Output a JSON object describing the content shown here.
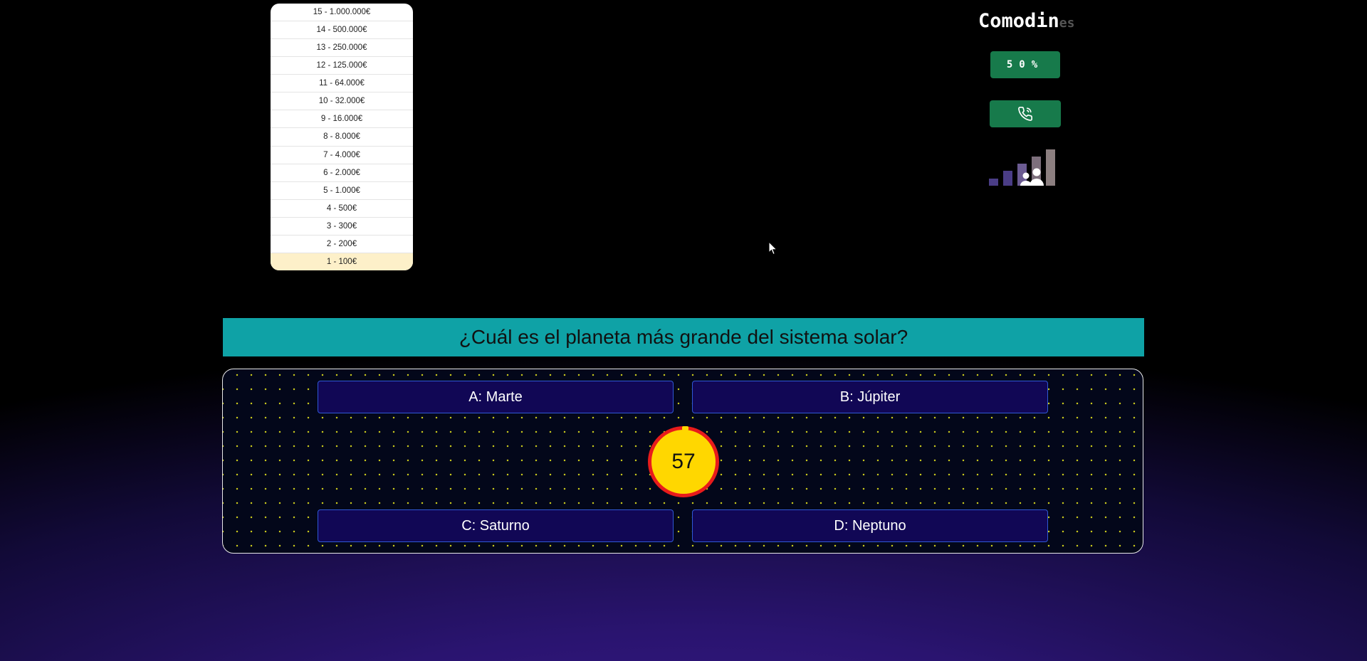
{
  "prize_ladder": {
    "levels": [
      "15 - 1.000.000€",
      "14 - 500.000€",
      "13 - 250.000€",
      "12 - 125.000€",
      "11 - 64.000€",
      "10 - 32.000€",
      "9 - 16.000€",
      "8 - 8.000€",
      "7 - 4.000€",
      "6 - 2.000€",
      "5 - 1.000€",
      "4 - 500€",
      "3 - 300€",
      "2 - 200€",
      "1 - 100€"
    ],
    "current_level": "1 - 100€",
    "current_color": "#fdf0c9"
  },
  "lifelines": {
    "title": "Comodin",
    "title_tail": "es",
    "fifty_label": "50%",
    "phone_icon": "phone-icon",
    "audience_icon": "audience-icon",
    "button_color": "#177a4b"
  },
  "question": {
    "text": "¿Cuál es el planeta más grande del sistema solar?",
    "background": "#0fa2a6"
  },
  "answers": {
    "a": "A: Marte",
    "b": "B: Júpiter",
    "c": "C: Saturno",
    "d": "D: Neptuno"
  },
  "timer": {
    "seconds": "57",
    "fill_color": "#ffd700",
    "ring_color": "#e81b1b"
  }
}
